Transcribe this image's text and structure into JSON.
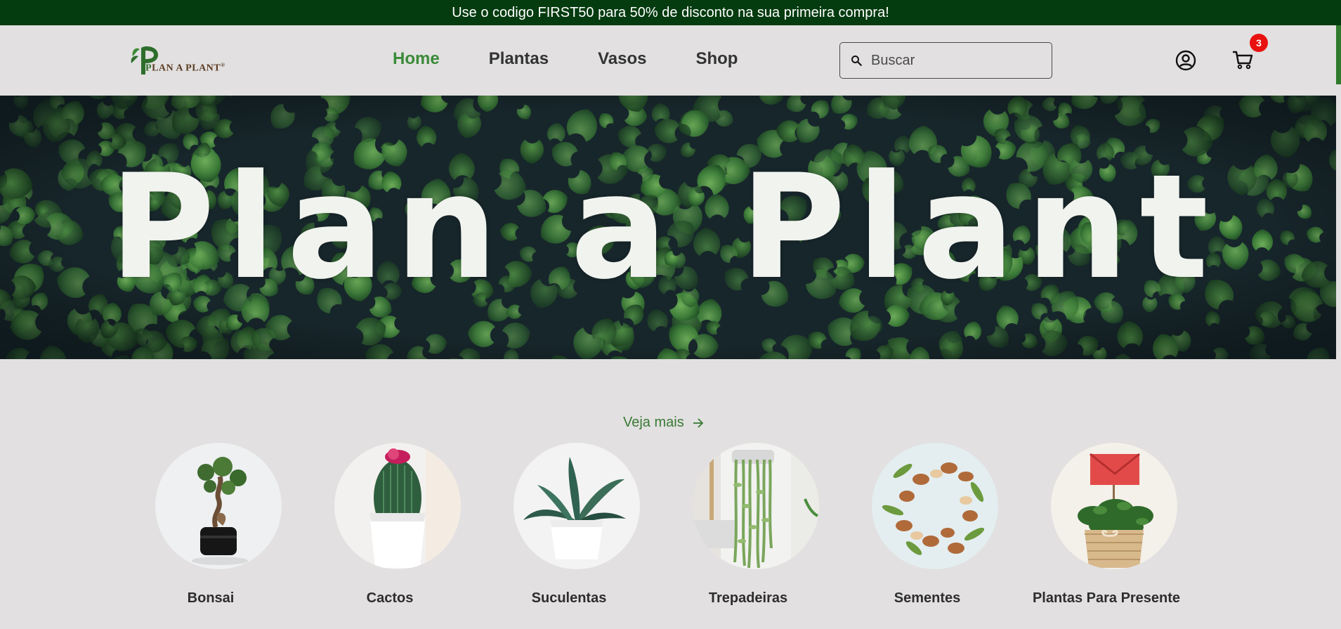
{
  "promo": {
    "text": "Use o codigo FIRST50 para 50% de disconto na sua primeira compra!"
  },
  "header": {
    "logo": {
      "letter": "P",
      "text_first": "P",
      "text_rest": "LAN A PLANT",
      "registered": "®"
    },
    "nav": [
      {
        "label": "Home",
        "active": true
      },
      {
        "label": "Plantas",
        "active": false
      },
      {
        "label": "Vasos",
        "active": false
      },
      {
        "label": "Shop",
        "active": false
      }
    ],
    "search": {
      "placeholder": "Buscar",
      "icon": "search-icon"
    },
    "user_icon": "user-circle-icon",
    "cart": {
      "icon": "cart-icon",
      "count": "3"
    }
  },
  "hero": {
    "title": "Plan a Plant"
  },
  "categories_section": {
    "see_more_label": "Veja mais",
    "see_more_icon": "arrow-right-icon",
    "items": [
      {
        "label": "Bonsai",
        "image": "bonsai-image"
      },
      {
        "label": "Cactos",
        "image": "cactus-image"
      },
      {
        "label": "Suculentas",
        "image": "succulent-image"
      },
      {
        "label": "Trepadeiras",
        "image": "trailing-plant-image"
      },
      {
        "label": "Sementes",
        "image": "seeds-image"
      },
      {
        "label": "Plantas Para Presente",
        "image": "gift-plant-image"
      }
    ]
  },
  "colors": {
    "promo_bg": "#043b0f",
    "accent_green": "#3a8a38",
    "page_bg": "#e2e0e0",
    "hero_bg": "#17262b",
    "badge_red": "#e8110f"
  }
}
